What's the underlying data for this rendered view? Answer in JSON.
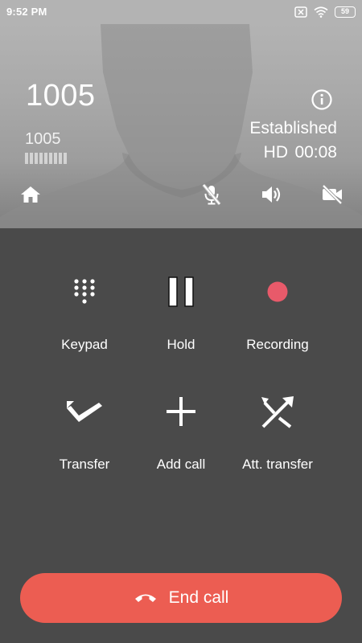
{
  "status_bar": {
    "time": "9:52 PM",
    "battery": "59",
    "icons": [
      "notification-blocked-icon",
      "wifi-icon",
      "battery-icon"
    ]
  },
  "call": {
    "caller_name": "1005",
    "caller_number": "1005",
    "state": "Established",
    "quality": "HD",
    "duration": "00:08"
  },
  "top_actions": [
    "home-icon",
    "mic-off-icon",
    "volume-icon",
    "video-off-icon"
  ],
  "actions": [
    {
      "label": "Keypad",
      "icon": "keypad-icon"
    },
    {
      "label": "Hold",
      "icon": "pause-icon"
    },
    {
      "label": "Recording",
      "icon": "record-icon"
    },
    {
      "label": "Transfer",
      "icon": "transfer-icon"
    },
    {
      "label": "Add call",
      "icon": "plus-icon"
    },
    {
      "label": "Att. transfer",
      "icon": "attended-transfer-icon"
    }
  ],
  "end_call": {
    "label": "End call",
    "icon": "hangup-icon"
  },
  "colors": {
    "background": "#4a4a4a",
    "end_call": "#ec5d52",
    "record": "#e85a6a"
  }
}
